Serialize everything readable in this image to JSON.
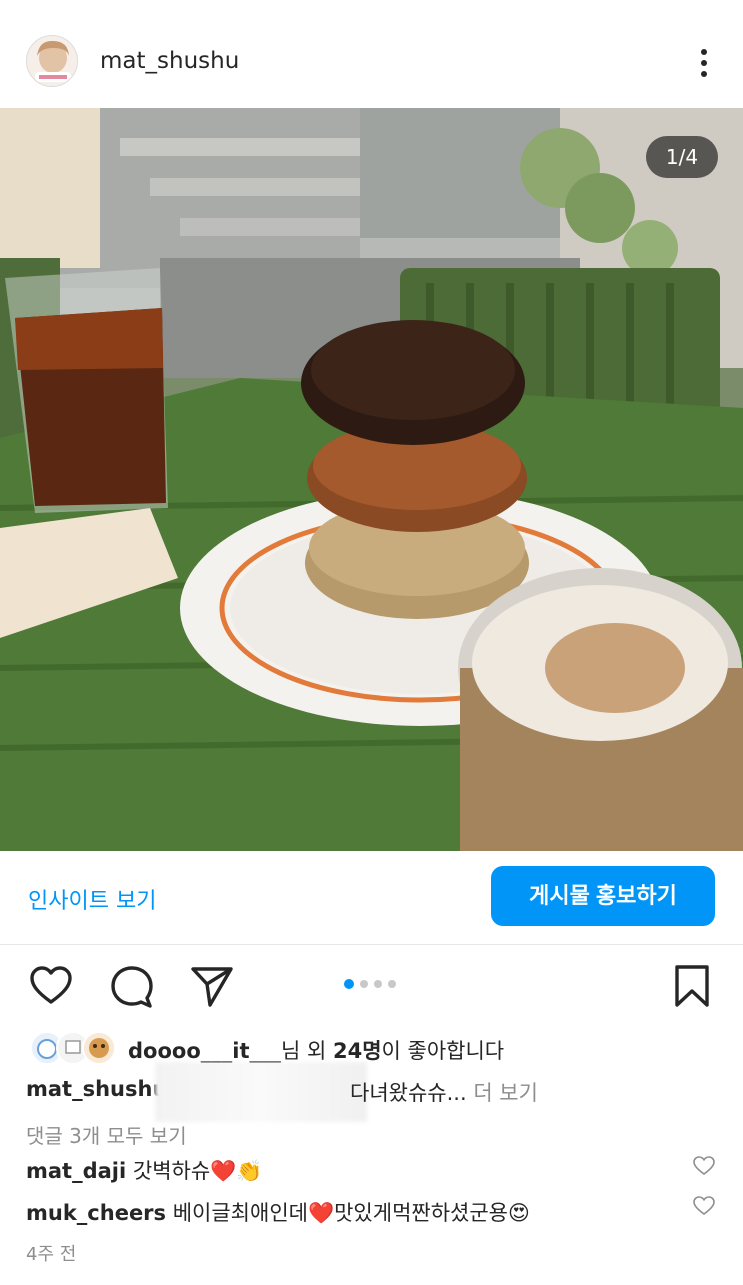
{
  "post": {
    "username": "mat_shushu",
    "image_counter": "1/4",
    "insight_link": "인사이트 보기",
    "promote_button": "게시물 홍보하기",
    "likes": {
      "prefix_user": "doooo___it___",
      "suffix_1": "님 외 ",
      "count": "24명",
      "suffix_2": "이 좋아합니다"
    },
    "caption": {
      "user": "mat_shushu",
      "text_visible": "다녀왔슈슈...",
      "more": " 더 보기"
    },
    "view_all_comments": "댓글 3개 모두 보기",
    "comments": [
      {
        "user": "mat_daji",
        "text": " 갓벽하슈❤️👏"
      },
      {
        "user": "muk_cheers",
        "text": " 베이글최애인데❤️맛있게먹짠하셨군용😍"
      }
    ],
    "timestamp": "4주 전"
  },
  "icons": {
    "more": "more-vertical-icon",
    "like": "heart-icon",
    "comment": "comment-icon",
    "share": "send-icon",
    "save": "bookmark-icon"
  },
  "carousel": {
    "total": 4,
    "current": 1
  },
  "colors": {
    "accent": "#0095f6",
    "text": "#262626",
    "muted": "#8e8e8e"
  }
}
